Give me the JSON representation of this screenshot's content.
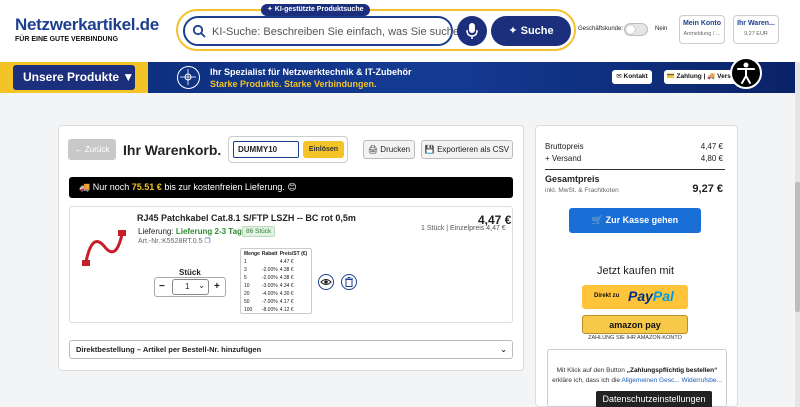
{
  "header": {
    "logo_main": "Netzwerkartikel.de",
    "logo_sub": "FÜR EINE GUTE VERBINDUNG",
    "ki_badge": "✦ KI-gestützte Produktsuche",
    "search_placeholder": "KI-Suche: Beschreiben Sie einfach, was Sie suchen ...",
    "search_button": "✦ Suche",
    "business_label": "Geschäftskunde:",
    "business_toggle_value": "Nein",
    "account_title": "Mein Konto",
    "account_sub": "Anmeldung / ...",
    "cart_title": "Ihr Waren...",
    "cart_sub": "9,27 EUR"
  },
  "nav": {
    "products_button": "Unsere Produkte ▼",
    "tagline_1": "Ihr Spezialist für Netzwerktechnik & IT-Zubehör",
    "tagline_2": "Starke Produkte. Starke Verbindungen.",
    "kontakt": "✉ Kontakt",
    "zahlung": "💳 Zahlung | 🚚 Versand"
  },
  "cart": {
    "back_button": "← Zurück",
    "title": "Ihr Warenkorb.",
    "coupon_value": "DUMMY10",
    "coupon_button": "Einlösen",
    "print_button": "Drucken",
    "export_button": "Exportieren als CSV",
    "shipping_prefix": "Nur noch",
    "shipping_amount": "75.51 €",
    "shipping_suffix": "bis zur kostenfreien Lieferung. 😊",
    "item": {
      "name": "RJ45 Patchkabel Cat.8.1 S/FTP LSZH -- BC rot 0,5m",
      "price": "4,47 €",
      "qty_info": "1 Stück | Einzelpreis 4,47 €",
      "delivery_label": "Lieferung:",
      "delivery_value": "Lieferung 2-3 Tage",
      "stock": "86 Stück",
      "article": "Art.-Nr.:K5528RT.0.5",
      "qty_label": "Stück",
      "qty_value": "1",
      "price_table": {
        "headers": [
          "Menge",
          "Rabatt",
          "Preis/ST (€)"
        ],
        "rows": [
          [
            "1",
            "",
            "4.47 €"
          ],
          [
            "3",
            "-2.00%",
            "4.38 €"
          ],
          [
            "5",
            "-2.00%",
            "4.38 €"
          ],
          [
            "10",
            "-3.00%",
            "4.34 €"
          ],
          [
            "20",
            "-4.00%",
            "4.30 €"
          ],
          [
            "50",
            "-7.00%",
            "4.17 €"
          ],
          [
            "100",
            "-8.00%",
            "4.12 €"
          ]
        ]
      }
    },
    "direct_order": "Direktbestellung – Artikel per Bestell-Nr. hinzufügen"
  },
  "summary": {
    "brutto_label": "Bruttopreis",
    "brutto_value": "4,47 €",
    "versand_label": "+ Versand",
    "versand_value": "4,80 €",
    "total_label": "Gesamtpreis",
    "total_sub": "inkl. MwSt. & Frachtkoten",
    "total_value": "9,27 €",
    "checkout_button": "🛒 Zur Kasse gehen",
    "buy_now": "Jetzt kaufen mit",
    "paypal_prefix": "Direkt zu",
    "paypal_pay": "Pay",
    "paypal_pal": "Pal",
    "amazon_pay": "amazon pay",
    "amazon_sub": "ZAHLUNG SIE IHR AMAZON-KONTO",
    "note_prefix": "Mit Klick auf den Button",
    "note_bold": "„Zahlungspflichtig bestellen“",
    "note_mid": "erkläre ich, dass ich die",
    "note_link1": "Allgemeinen Gesc...",
    "note_link2": "Widerrufsbe...",
    "cookie": "Datenschutzeinstellungen"
  },
  "colors": {
    "brand_blue": "#1c2f7c",
    "accent_yellow": "#f3c328",
    "checkout_blue": "#1a6fd6"
  }
}
